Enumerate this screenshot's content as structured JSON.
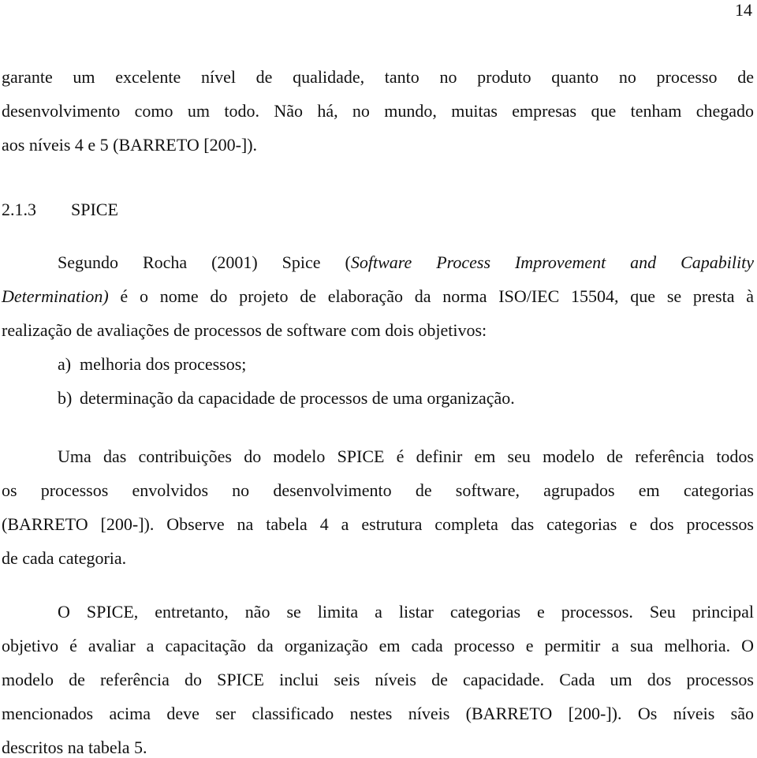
{
  "page_number": "14",
  "paragraph_1": {
    "lines": [
      "garante um excelente nível de qualidade, tanto no produto quanto no processo de",
      "desenvolvimento como um todo. Não há, no mundo, muitas empresas que tenham chegado",
      "aos níveis 4 e 5 (BARRETO [200-])."
    ]
  },
  "section_heading": {
    "number": "2.1.3",
    "title": "SPICE"
  },
  "paragraph_2": {
    "line1_pre": "Segundo Rocha (2001) Spice (",
    "line1_italic": "Software Process Improvement and Capability",
    "line2_italic": "Determination)",
    "line2_post": " é o nome do projeto de elaboração da norma ISO/IEC 15504, que se presta à",
    "line3": "realização de avaliações de processos de software com dois objetivos:"
  },
  "list": [
    {
      "marker": "a)",
      "text": "melhoria dos processos;"
    },
    {
      "marker": "b)",
      "text": "determinação da capacidade de processos de uma organização."
    }
  ],
  "paragraph_3": {
    "lines": [
      "Uma das contribuições do modelo SPICE é definir em seu modelo de referência todos",
      "os processos envolvidos no desenvolvimento de software, agrupados em categorias",
      "(BARRETO [200-]). Observe na tabela 4 a estrutura completa das categorias e dos processos",
      "de cada categoria."
    ]
  },
  "paragraph_4": {
    "lines": [
      "O SPICE, entretanto, não se limita a listar categorias e processos. Seu principal",
      "objetivo é avaliar a capacitação da organização em cada processo e permitir a sua melhoria. O",
      "modelo de referência do SPICE inclui seis níveis de capacidade. Cada um dos processos",
      "mencionados acima deve ser classificado nestes níveis (BARRETO [200-]). Os níveis são",
      "descritos na tabela 5."
    ]
  }
}
